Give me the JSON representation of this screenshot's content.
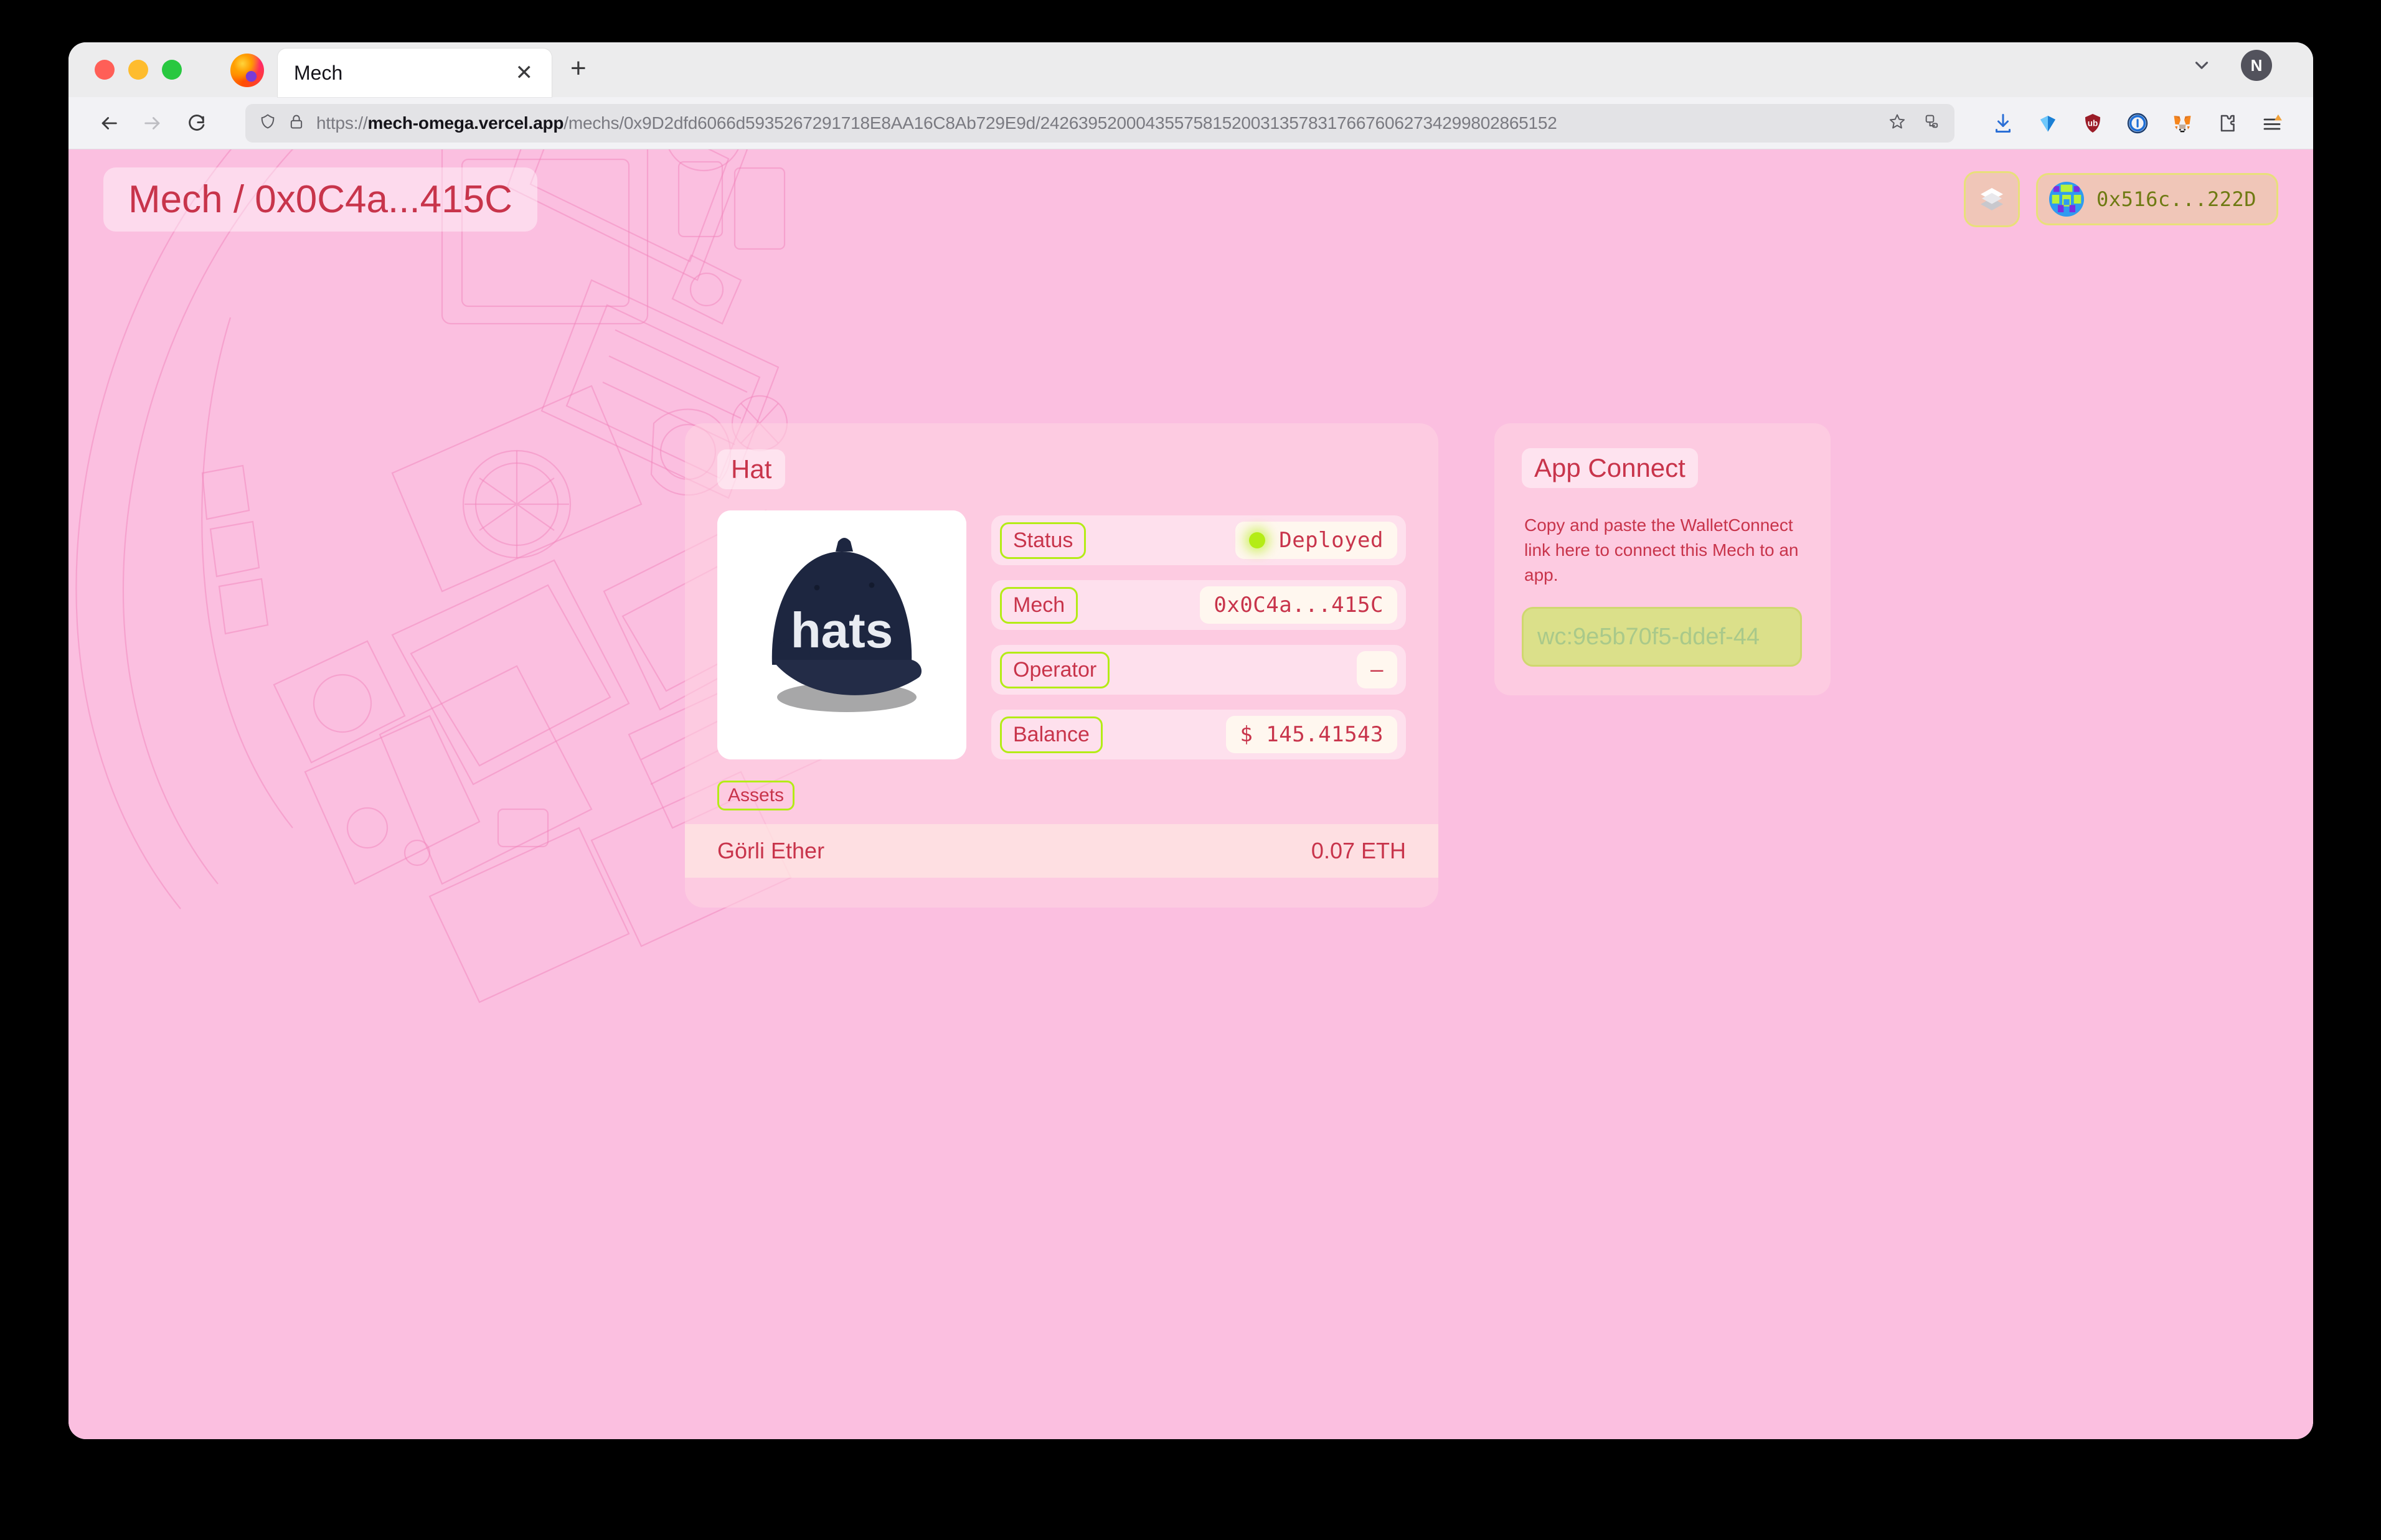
{
  "browser": {
    "tab": {
      "title": "Mech",
      "close_label": "✕"
    },
    "new_tab_label": "+",
    "profile_initial": "N",
    "url": {
      "scheme": "https://",
      "domain": "mech-omega.vercel.app",
      "path": "/mechs/0x9D2dfd6066d5935267291718E8AA16C8Ab729E9d/242639520004355758152003135783176676062734299802865152"
    },
    "toolbar_icons": [
      "back-icon",
      "forward-icon",
      "reload-icon",
      "shield-icon",
      "lock-icon",
      "bookmark-star-icon",
      "save-to-pocket-icon",
      "downloads-icon",
      "blue-diamond-extension-icon",
      "ublock-origin-icon",
      "onepassword-icon",
      "metamask-icon",
      "extensions-puzzle-icon",
      "app-menu-icon"
    ]
  },
  "page": {
    "title": "Mech / 0x0C4a...415C",
    "header": {
      "layers_button": "layers-icon",
      "wallet_address": "0x516c...222D"
    },
    "card": {
      "title": "Hat",
      "nft_image_caption": "hats",
      "rows": [
        {
          "label": "Status",
          "value": "Deployed",
          "has_dot": true
        },
        {
          "label": "Mech",
          "value": "0x0C4a...415C",
          "has_dot": false
        },
        {
          "label": "Operator",
          "value": "–",
          "has_dot": false
        },
        {
          "label": "Balance",
          "value": "$ 145.41543",
          "has_dot": false
        }
      ],
      "assets_label": "Assets",
      "assets": [
        {
          "name": "Görli Ether",
          "amount": "0.07  ETH"
        }
      ]
    },
    "app_connect": {
      "title": "App Connect",
      "description": "Copy and paste the WalletConnect link here to connect this Mech to an app.",
      "input_placeholder": "wc:9e5b70f5-ddef-44"
    }
  },
  "colors": {
    "page_background": "#fbbfe0",
    "accent_red": "#c8344b",
    "accent_green": "#b4ec16",
    "chip_background": "#f0c6b8",
    "chip_border": "#e8e07a",
    "wc_input_background": "#dbe08a"
  }
}
